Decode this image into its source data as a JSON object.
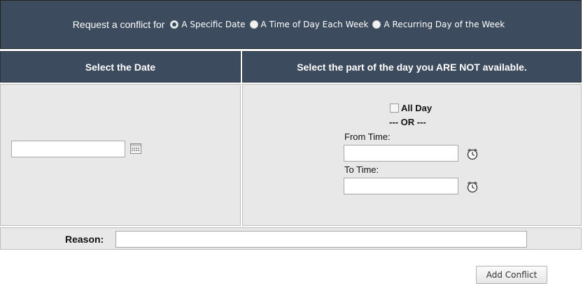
{
  "header": {
    "request_label": "Request a conflict for",
    "options": [
      {
        "label": "A Specific Date",
        "selected": true
      },
      {
        "label": "A Time of Day Each Week",
        "selected": false
      },
      {
        "label": "A Recurring Day of the Week",
        "selected": false
      }
    ]
  },
  "columns": {
    "left_title": "Select the Date",
    "right_title": "Select the part of the day you ARE NOT available."
  },
  "date_field": {
    "value": ""
  },
  "time_section": {
    "all_day_label": "All Day",
    "all_day_checked": false,
    "or_text": "--- OR ---",
    "from_label": "From Time:",
    "from_value": "",
    "to_label": "To Time:",
    "to_value": ""
  },
  "reason": {
    "label": "Reason:",
    "value": ""
  },
  "actions": {
    "add_conflict_label": "Add Conflict"
  },
  "colors": {
    "header_bg": "#3d4b5e",
    "panel_bg": "#e8e8e8"
  },
  "icons": {
    "calendar": "calendar-icon",
    "clock": "alarm-clock-icon"
  }
}
